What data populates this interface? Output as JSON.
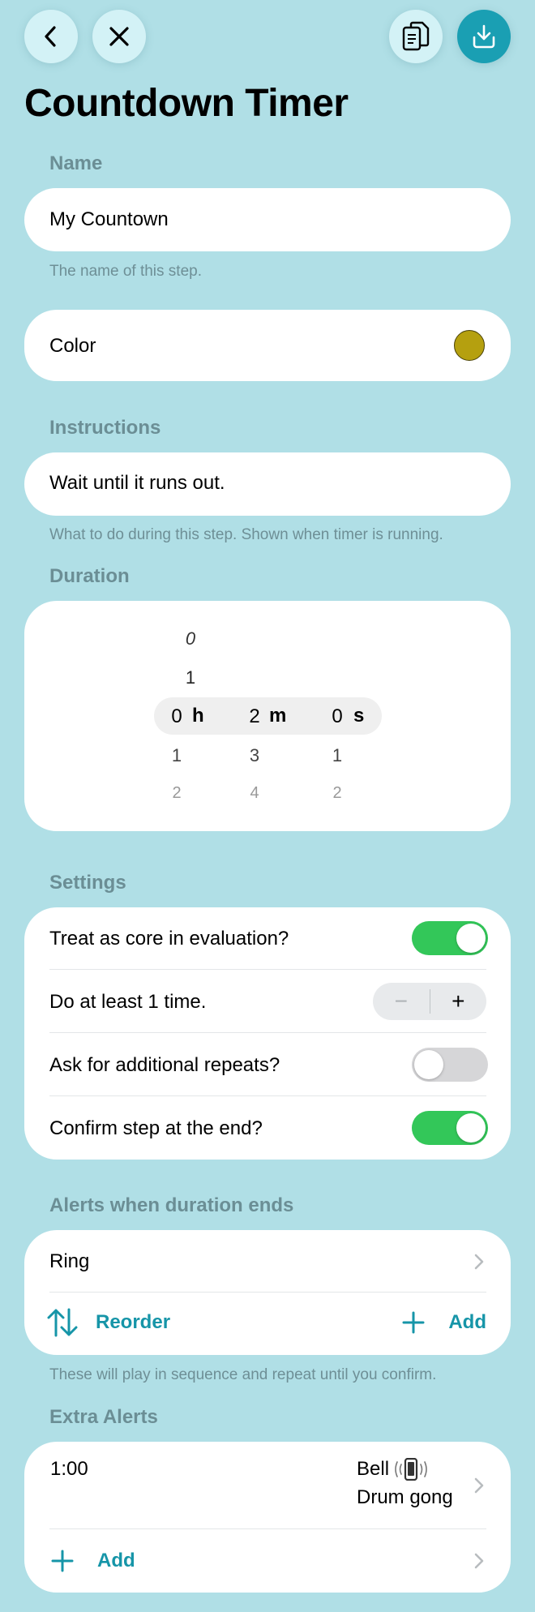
{
  "header": {
    "title": "Countdown Timer"
  },
  "name": {
    "label": "Name",
    "value": "My Countown",
    "helper": "The name of this step."
  },
  "color": {
    "label": "Color",
    "swatch": "#b5a00f"
  },
  "instructions": {
    "label": "Instructions",
    "value": "Wait until it runs out.",
    "helper": "What to do during this step. Shown when timer is running."
  },
  "duration": {
    "label": "Duration",
    "hours": {
      "above": [],
      "selected": "0",
      "below": [
        "1",
        "2"
      ],
      "unit": "h"
    },
    "minutes": {
      "above": [
        "0",
        "1"
      ],
      "selected": "2",
      "below": [
        "3",
        "4"
      ],
      "unit": "m"
    },
    "seconds": {
      "above": [],
      "selected": "0",
      "below": [
        "1",
        "2"
      ],
      "unit": "s"
    }
  },
  "settings": {
    "label": "Settings",
    "core": {
      "label": "Treat as core in evaluation?",
      "on": true
    },
    "repeat": {
      "label": "Do at least 1 time.",
      "minus": "−",
      "plus": "+"
    },
    "additional": {
      "label": "Ask for additional repeats?",
      "on": false
    },
    "confirm": {
      "label": "Confirm step at the end?",
      "on": true
    }
  },
  "alerts": {
    "label": "Alerts when duration ends",
    "items": [
      "Ring"
    ],
    "reorder_label": "Reorder",
    "add_label": "Add",
    "helper": "These will play in sequence and repeat until you confirm."
  },
  "extra_alerts": {
    "label": "Extra Alerts",
    "items": [
      {
        "time": "1:00",
        "sound1": "Bell",
        "sound2": "Drum gong"
      }
    ],
    "add_label": "Add"
  },
  "colors": {
    "accent": "#1695a8",
    "toggle_on": "#33c759",
    "background": "#b0dfe6"
  }
}
